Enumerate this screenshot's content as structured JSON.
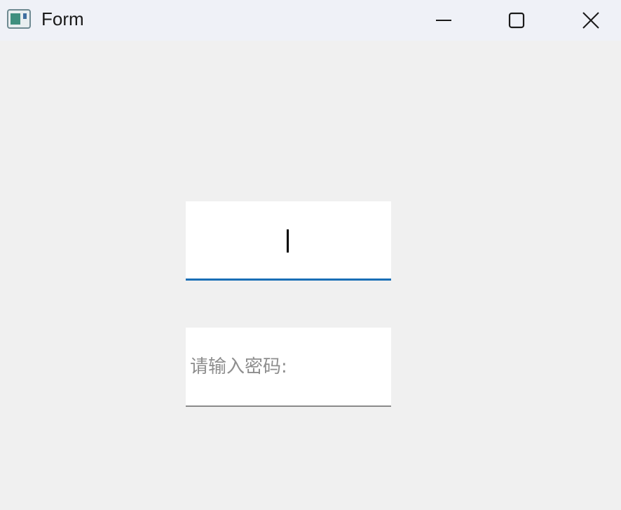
{
  "window": {
    "title": "Form",
    "app_icon": "window-app-icon",
    "controls": {
      "minimize_icon": "minimize-icon",
      "maximize_icon": "maximize-icon",
      "close_icon": "close-icon"
    }
  },
  "form": {
    "username": {
      "value": "",
      "placeholder": ""
    },
    "password": {
      "value": "",
      "placeholder": "请输入密码:"
    }
  },
  "colors": {
    "titlebar_bg": "#eff1f7",
    "client_bg": "#f0f0f0",
    "focus_accent": "#1a6fb6",
    "field_bg": "#ffffff",
    "placeholder_text": "#8e8e8e"
  }
}
